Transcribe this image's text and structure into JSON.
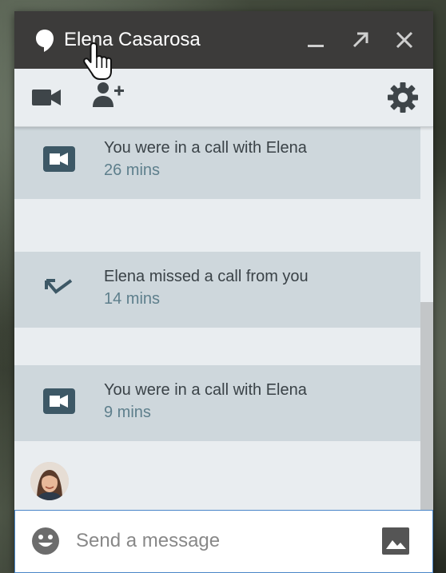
{
  "window": {
    "title": "Elena Casarosa",
    "accent_color": "#4a86c8",
    "titlebar_color": "#3c3b3a"
  },
  "toolbar": {
    "video_call_icon": "video-camera-icon",
    "add_person_icon": "person-add-icon",
    "settings_icon": "gear-icon"
  },
  "messages": [
    {
      "icon": "video-camera-icon",
      "title": "You were in a call with Elena",
      "subtitle": "26 mins"
    },
    {
      "icon": "missed-call-icon",
      "title": "Elena missed a call from you",
      "subtitle": "14 mins"
    },
    {
      "icon": "video-camera-icon",
      "title": "You were in a call with Elena",
      "subtitle": "9 mins"
    }
  ],
  "composer": {
    "placeholder": "Send a message",
    "emoji_icon": "emoji-icon",
    "image_icon": "image-icon"
  }
}
